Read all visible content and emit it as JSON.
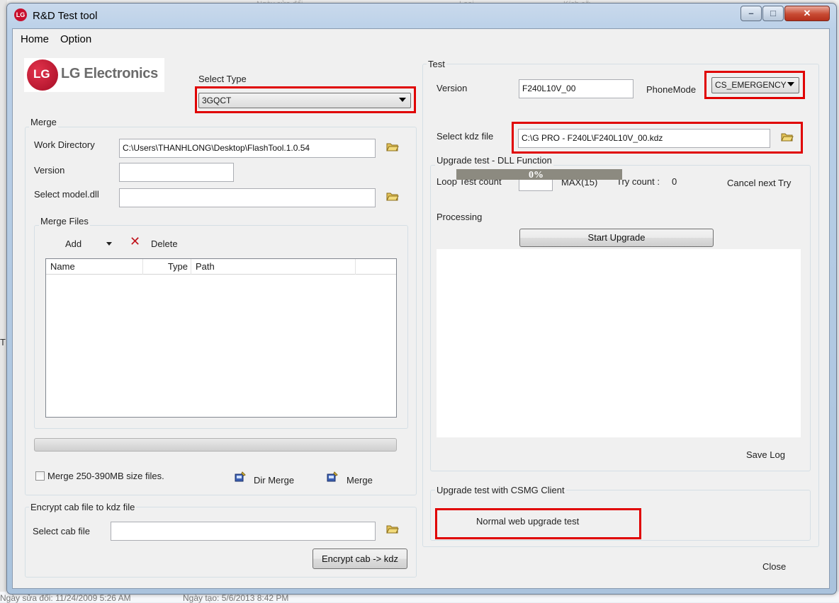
{
  "window": {
    "title": "R&D Test tool",
    "logo_text": "LG"
  },
  "menu": [
    "Home",
    "Option"
  ],
  "brand": {
    "name": "LG Electronics",
    "mark": "LG"
  },
  "select_type": {
    "label": "Select Type",
    "value": "3GQCT"
  },
  "merge": {
    "group_label": "Merge",
    "work_directory_label": "Work Directory",
    "work_directory_value": "C:\\Users\\THANHLONG\\Desktop\\FlashTool.1.0.54",
    "version_label": "Version",
    "version_value": "",
    "model_label": "Select model.dll",
    "model_value": "",
    "files_group_label": "Merge Files",
    "add_label": "Add",
    "delete_label": "Delete",
    "columns": [
      "Name",
      "Type",
      "Path"
    ],
    "rows": [],
    "size_checkbox_label": "Merge 250-390MB size files.",
    "size_checkbox_checked": false,
    "dir_merge_label": "Dir Merge",
    "merge_label": "Merge"
  },
  "encrypt": {
    "group_label": "Encrypt cab file to kdz file",
    "cab_label": "Select cab file",
    "cab_value": "",
    "button_label": "Encrypt cab -> kdz"
  },
  "test": {
    "group_label": "Test",
    "version_label": "Version",
    "version_value": "F240L10V_00",
    "phone_mode_label": "PhoneMode",
    "phone_mode_value": "CS_EMERGENCY",
    "kdz_label": "Select kdz file",
    "kdz_value": "C:\\G PRO - F240L\\F240L10V_00.kdz",
    "upgrade_group_label": "Upgrade test - DLL Function",
    "progress_text": "0%",
    "loop_label": "Loop Test count",
    "loop_value": "",
    "max_label": "MAX(15)",
    "try_label": "Try count :",
    "try_value": "0",
    "cancel_label": "Cancel next Try",
    "processing_label": "Processing",
    "start_label": "Start Upgrade",
    "save_log_label": "Save Log",
    "csmg_group_label": "Upgrade test with CSMG Client",
    "normal_web_label": "Normal web upgrade test",
    "close_label": "Close"
  },
  "background": {
    "top_text_1": "Ngày sửa đổi",
    "top_text_2": "Loại",
    "top_text_3": "Kích cỡ",
    "bottom_text_1": "Ngày sửa đổi: 11/24/2009 5:26 AM",
    "bottom_text_2": "Ngày tạo: 5/6/2013 8:42 PM",
    "left_text": "T"
  },
  "colors": {
    "highlight_red": "#e00000",
    "lg_red": "#c8102e"
  }
}
